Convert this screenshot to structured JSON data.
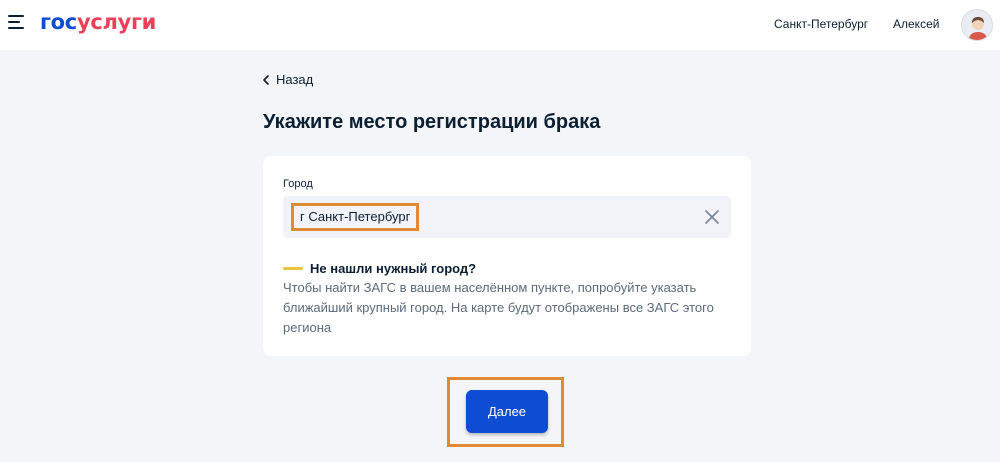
{
  "header": {
    "logo_part1": "гос",
    "logo_part2": "услуги",
    "city": "Санкт-Петербург",
    "user": "Алексей"
  },
  "nav": {
    "back_label": "Назад"
  },
  "page": {
    "title": "Укажите место регистрации брака"
  },
  "form": {
    "city_label": "Город",
    "city_value": "г Санкт-Петербург",
    "hint_title": "Не нашли нужный город?",
    "hint_text": "Чтобы найти ЗАГС в вашем населённом пункте, попробуйте указать ближайший крупный город. На карте будут отображены все ЗАГС этого региона"
  },
  "actions": {
    "next_label": "Далее"
  },
  "colors": {
    "brand_blue": "#0d4cd3",
    "brand_red": "#ee3f58",
    "highlight_orange": "#e08a35",
    "hint_yellow": "#ebc23d",
    "background": "#f3f5f9"
  },
  "icons": {
    "menu": "burger-menu-icon",
    "avatar": "user-avatar-icon",
    "back": "chevron-left-icon",
    "clear": "close-icon"
  }
}
